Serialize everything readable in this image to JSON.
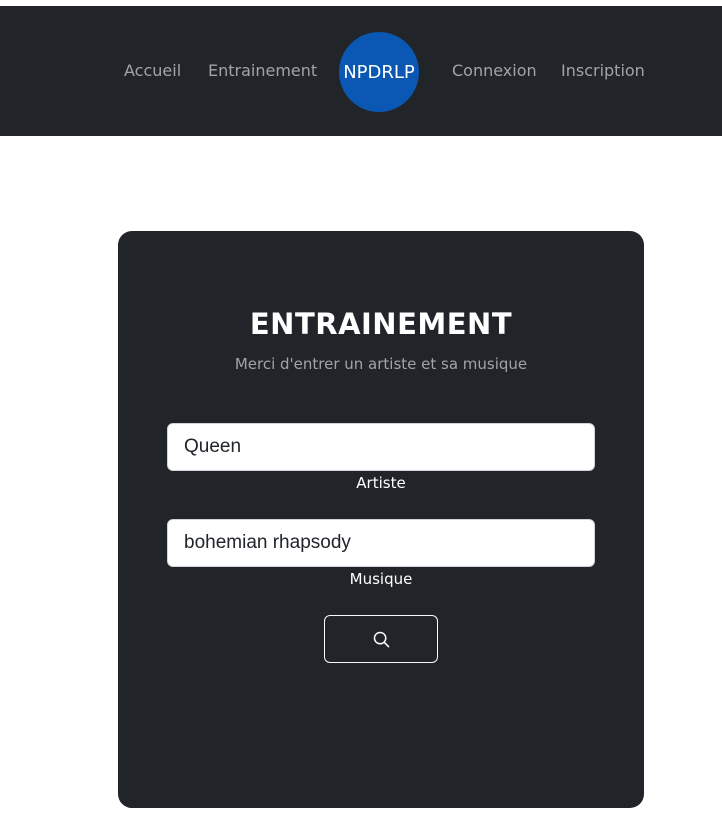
{
  "nav": {
    "links": [
      "Accueil",
      "Entrainement",
      "Connexion",
      "Inscription"
    ],
    "logo_text": "NPDRLP"
  },
  "form": {
    "title": "ENTRAINEMENT",
    "subtitle": "Merci d'entrer un artiste et sa musique",
    "artist": {
      "value": "Queen",
      "label": "Artiste"
    },
    "music": {
      "value": "bohemian rhapsody",
      "label": "Musique"
    },
    "search_icon": "search-icon"
  },
  "colors": {
    "navbar_bg": "#212529",
    "card_bg": "#212529",
    "logo_bg": "#0a57b4",
    "nav_link": "#a1a4a7",
    "text_light": "#ffffff"
  }
}
